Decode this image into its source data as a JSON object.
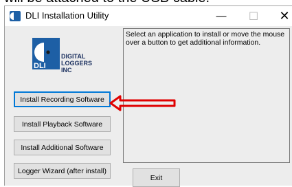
{
  "doc_text": "will be attached to the USB cable.",
  "window": {
    "title": "DLI Installation Utility",
    "controls": {
      "minimize": "—",
      "maximize": "☐",
      "close": "✕"
    }
  },
  "logo": {
    "line1": "DIGITAL",
    "line2": "LOGGERS",
    "line3": "INC",
    "badge": "DLI"
  },
  "info_text": "Select an application to install or move the mouse over a button to get additional information.",
  "buttons": {
    "install_recording": "Install Recording Software",
    "install_playback": "Install Playback Software",
    "install_additional": "Install Additional Software",
    "logger_wizard": "Logger Wizard (after install)",
    "exit": "Exit"
  },
  "colors": {
    "arrow": "#e00000",
    "logo_blue": "#1d5fa5",
    "focus": "#0078d7"
  }
}
